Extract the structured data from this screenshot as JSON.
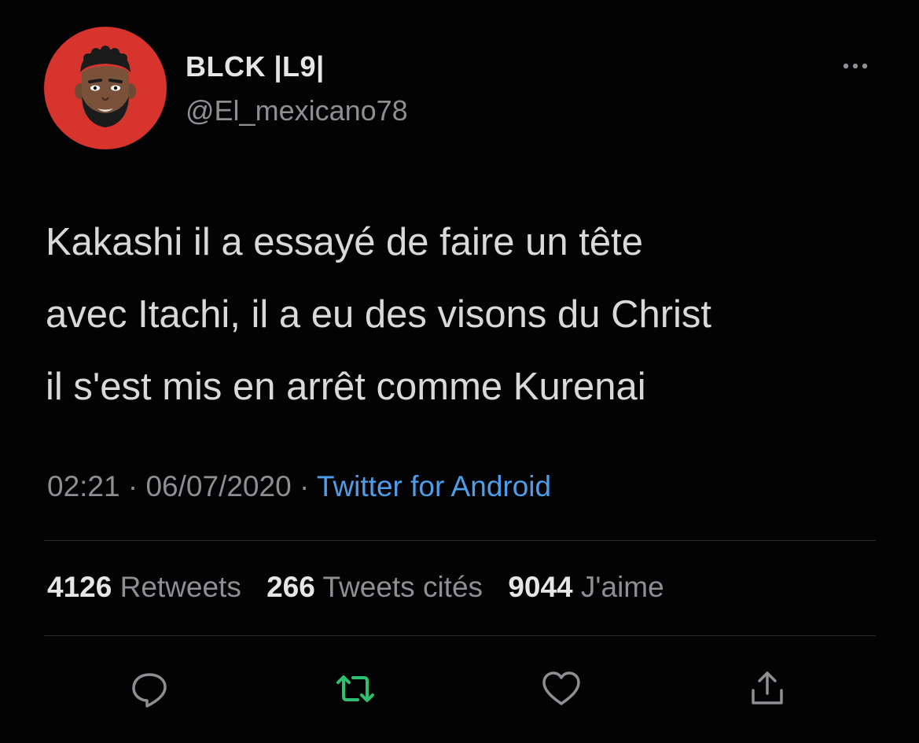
{
  "user": {
    "display_name": "BLCK |L9|",
    "handle": "@El_mexicano78",
    "avatar_icon": "cartoon-avatar-icon",
    "avatar_bg": "#d6342c"
  },
  "tweet": {
    "text": "Kakashi il a essayé de faire un tête\navec Itachi, il a eu des visons du Christ\nil s'est mis en arrêt comme Kurenai"
  },
  "meta": {
    "time": "02:21",
    "separator": "·",
    "date": "06/07/2020",
    "source": "Twitter for Android",
    "source_color": "#4f9ce8"
  },
  "stats": {
    "retweets_count": "4126",
    "retweets_label": "Retweets",
    "quotes_count": "266",
    "quotes_label": "Tweets cités",
    "likes_count": "9044",
    "likes_label": "J'aime"
  },
  "actions": [
    {
      "icon": "reply-icon"
    },
    {
      "icon": "retweet-icon",
      "color": "#2fbf71"
    },
    {
      "icon": "like-icon"
    },
    {
      "icon": "share-icon"
    }
  ],
  "more_icon": "more-options-icon"
}
